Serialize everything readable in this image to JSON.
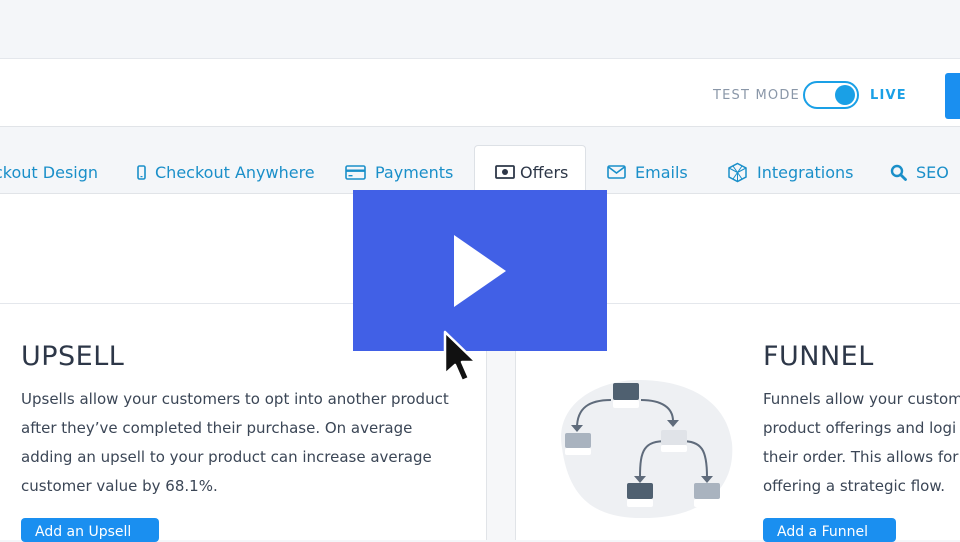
{
  "header": {
    "test_mode_label": "TEST MODE",
    "live_label": "LIVE",
    "mode_toggle_state": "live"
  },
  "tabs": [
    {
      "label": "ckout Design",
      "icon": "none"
    },
    {
      "label": "Checkout Anywhere",
      "icon": "mobile-icon"
    },
    {
      "label": "Payments",
      "icon": "credit-card-icon"
    },
    {
      "label": "Offers",
      "icon": "money-icon",
      "active": true
    },
    {
      "label": "Emails",
      "icon": "envelope-icon"
    },
    {
      "label": "Integrations",
      "icon": "cube-icon"
    },
    {
      "label": "SEO",
      "icon": "search-icon"
    }
  ],
  "upsell": {
    "title": "UPSELL",
    "desc_lines": [
      "Upsells allow your customers to opt into another product",
      "after they’ve completed their purchase. On average",
      "adding an upsell to your product can increase average",
      "customer value by 68.1%."
    ],
    "button_label": "Add an Upsell"
  },
  "funnel": {
    "title": "FUNNEL",
    "desc_lines": [
      "Funnels allow your custom",
      "product offerings and logi",
      "their order. This allows for",
      "offering a strategic flow."
    ],
    "button_label": "Add a Funnel"
  },
  "video": {
    "overlay": "play-button",
    "color": "#4160e6"
  },
  "colors": {
    "accent": "#1a8fc9",
    "button": "#1a8ff0",
    "text_dark": "#2d3748"
  }
}
